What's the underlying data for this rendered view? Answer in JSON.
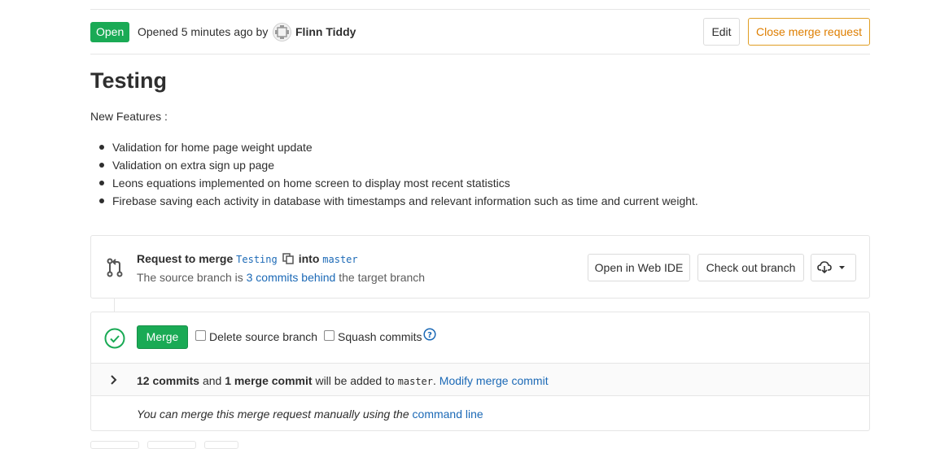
{
  "header": {
    "status": "Open",
    "opened_text": "Opened 5 minutes ago by",
    "author": "Flinn Tiddy",
    "edit_label": "Edit",
    "close_label": "Close merge request"
  },
  "title": "Testing",
  "description": {
    "lead": "New Features :",
    "items": [
      "Validation for home page weight update",
      "Validation on extra sign up page",
      "Leons equations implemented on home screen to display most recent statistics",
      "Firebase saving each activity in database with timestamps and relevant information such as time and current weight."
    ]
  },
  "merge_request": {
    "prefix": "Request to merge",
    "source_branch": "Testing",
    "into": "into",
    "target_branch": "master",
    "status_prefix": "The source branch is",
    "behind_link": "3 commits behind",
    "status_suffix": "the target branch",
    "web_ide_label": "Open in Web IDE",
    "checkout_label": "Check out branch"
  },
  "merge_widget": {
    "merge_label": "Merge",
    "delete_source_label": "Delete source branch",
    "squash_label": "Squash commits",
    "commits_count": "12 commits",
    "and_text": "and",
    "merge_commit": "1 merge commit",
    "added_text": "will be added to",
    "target_branch": "master",
    "period": ".",
    "modify_link": "Modify merge commit",
    "manual_text": "You can merge this merge request manually using the",
    "command_line_link": "command line"
  },
  "colors": {
    "success": "#1aaa55",
    "warning": "#de7e00",
    "link": "#1b69b6"
  },
  "icons": [
    "avatar",
    "copy-icon",
    "branch-icon",
    "download-icon",
    "check-circle-icon",
    "help-icon",
    "chevron-right-icon"
  ]
}
